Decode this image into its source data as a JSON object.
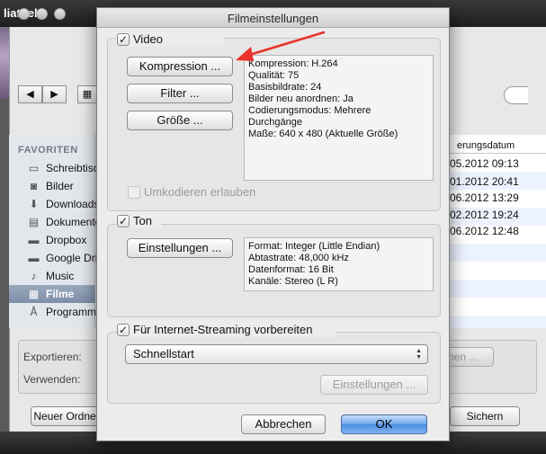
{
  "background": {
    "app_title": "liathek",
    "sidebar": {
      "header": "FAVORITEN",
      "items": [
        {
          "label": "Schreibtisch",
          "icon": "desktop-icon",
          "glyph": "▭"
        },
        {
          "label": "Bilder",
          "icon": "camera-icon",
          "glyph": "◙"
        },
        {
          "label": "Downloads",
          "icon": "download-icon",
          "glyph": "⬇"
        },
        {
          "label": "Dokumente",
          "icon": "documents-icon",
          "glyph": "▤"
        },
        {
          "label": "Dropbox",
          "icon": "folder-icon",
          "glyph": "▬"
        },
        {
          "label": "Google Drive",
          "icon": "folder-icon",
          "glyph": "▬"
        },
        {
          "label": "Music",
          "icon": "music-icon",
          "glyph": "♪"
        },
        {
          "label": "Filme",
          "icon": "film-icon",
          "glyph": "▦",
          "selected": true
        },
        {
          "label": "Programme",
          "icon": "applications-icon",
          "glyph": "Å"
        }
      ]
    },
    "file_list": {
      "column_header": "erungsdatum",
      "dates": [
        "05.2012 09:13",
        "01.2012 20:41",
        "06.2012 13:29",
        "02.2012 19:24",
        "06.2012 12:48"
      ]
    },
    "export_label": "Exportieren:",
    "use_label": "Verwenden:",
    "options_button": "nen ...",
    "new_folder_button": "Neuer Ordner",
    "save_button": "Sichern"
  },
  "dialog": {
    "title": "Filmeinstellungen",
    "video": {
      "title": "Video",
      "checked": true,
      "compression_button": "Kompression ...",
      "filter_button": "Filter ...",
      "size_button": "Größe ...",
      "info": [
        "Kompression: H.264",
        "Qualität: 75",
        "Basisbildrate: 24",
        "Bilder neu anordnen: Ja",
        "Codierungsmodus: Mehrere",
        "Durchgänge",
        "Maße: 640 x 480 (Aktuelle Größe)"
      ],
      "transcode_label": "Umkodieren erlauben",
      "transcode_checked": false
    },
    "sound": {
      "title": "Ton",
      "checked": true,
      "settings_button": "Einstellungen ...",
      "info": [
        "Format: Integer (Little Endian)",
        "Abtastrate: 48,000 kHz",
        "Datenformat: 16 Bit",
        "Kanäle: Stereo (L R)"
      ]
    },
    "streaming": {
      "title": "Für Internet-Streaming vorbereiten",
      "checked": true,
      "selected_option": "Schnellstart",
      "settings_button": "Einstellungen ..."
    },
    "cancel_button": "Abbrechen",
    "ok_button": "OK"
  },
  "annotation": {
    "color": "#e8322a"
  }
}
